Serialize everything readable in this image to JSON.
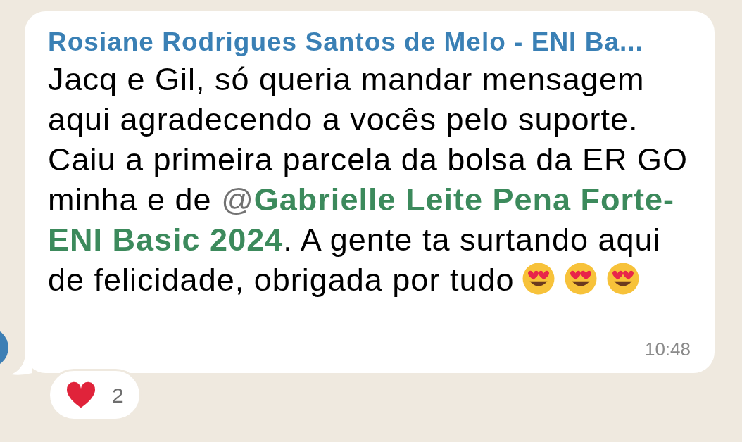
{
  "sender": {
    "name": "Rosiane Rodrigues Santos de Melo - ENI Ba..."
  },
  "message": {
    "lines": [
      [
        {
          "kind": "text",
          "text": "Jacq e Gil, só queria mandar mensagem"
        }
      ],
      [
        {
          "kind": "text",
          "text": "aqui agradecendo a vocês pelo suporte."
        }
      ],
      [
        {
          "kind": "text",
          "text": "Caiu a primeira parcela da bolsa da ER GO"
        }
      ],
      [
        {
          "kind": "text",
          "text": "minha e de "
        },
        {
          "kind": "mention",
          "at": "@",
          "text": "Gabrielle Leite Pena Forte-"
        }
      ],
      [
        {
          "kind": "mention",
          "text": "ENI Basic 2024"
        },
        {
          "kind": "text",
          "text": ". A gente ta surtando aqui"
        }
      ],
      [
        {
          "kind": "text",
          "text": "de felicidade, obrigada por tudo"
        },
        {
          "kind": "emoji"
        },
        {
          "kind": "emoji"
        },
        {
          "kind": "emoji"
        }
      ]
    ]
  },
  "time": "10:48",
  "reaction": {
    "count": "2"
  }
}
